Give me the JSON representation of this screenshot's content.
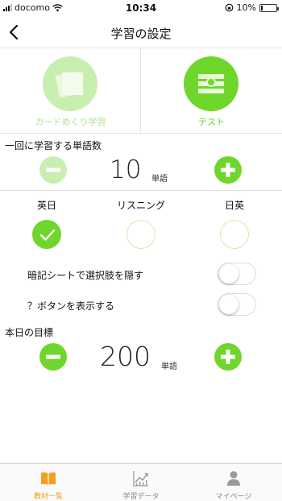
{
  "status_bar": {
    "carrier": "docomo",
    "time": "10:34",
    "battery": "10%",
    "battery_level": 0.1
  },
  "nav": {
    "title": "学習の設定"
  },
  "modes": [
    {
      "label": "カードめくり学習",
      "selected": false
    },
    {
      "label": "テスト",
      "selected": true
    }
  ],
  "words_per_session": {
    "label": "一回に学習する単語数",
    "value": "10",
    "unit": "単語"
  },
  "directions": [
    {
      "label": "英日",
      "selected": true
    },
    {
      "label": "リスニング",
      "selected": false
    },
    {
      "label": "日英",
      "selected": false
    }
  ],
  "toggles": [
    {
      "label": "暗記シートで選択肢を隠す",
      "on": false
    },
    {
      "label": "？ボタンを表示する",
      "on": false
    }
  ],
  "daily_goal": {
    "label": "本日の目標",
    "value": "200",
    "unit": "単語"
  },
  "tabs": [
    {
      "label": "教材一覧",
      "icon": "book-icon",
      "active": true
    },
    {
      "label": "学習データ",
      "icon": "chart-icon",
      "active": false
    },
    {
      "label": "マイページ",
      "icon": "person-icon",
      "active": false
    }
  ],
  "colors": {
    "accent": "#6fd62b",
    "accent_light": "#c9efb0",
    "tab_active": "#f0a11f"
  }
}
